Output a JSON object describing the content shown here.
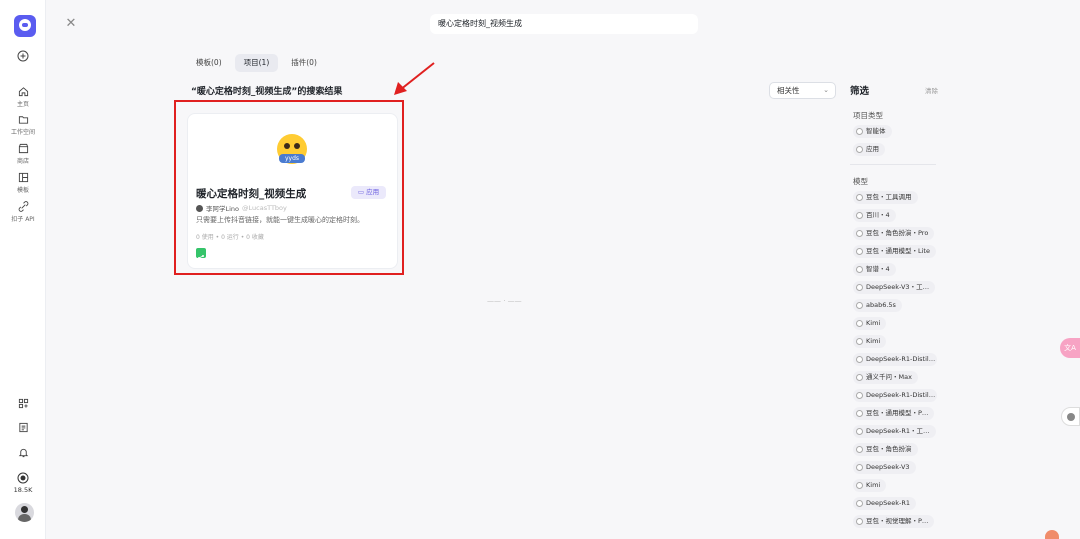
{
  "search": {
    "query": "暖心定格时刻_视频生成"
  },
  "tabs": [
    {
      "label": "模板(0)"
    },
    {
      "label": "项目(1)"
    },
    {
      "label": "插件(0)"
    }
  ],
  "results": {
    "title": "“暖心定格时刻_视频生成”的搜索结果"
  },
  "sort": {
    "value": "相关性"
  },
  "card": {
    "emoji_tag": "yyds",
    "title": "暖心定格时刻_视频生成",
    "badge": "应用",
    "author": "李阿学Lino",
    "handle": "@LucasTTboy",
    "desc": "只需要上传抖音链接，就能一键生成暖心的定格时刻。",
    "stats": "0 使用 • 0 运行 • 0 收藏"
  },
  "end_marker": "—— · ——",
  "rail": {
    "home": "主页",
    "workspace": "工作空间",
    "store": "商店",
    "templates": "模板",
    "api": "扣子 API",
    "count": "18.5K"
  },
  "filters": {
    "title": "筛选",
    "clear": "清除",
    "project_type_title": "项目类型",
    "project_types": [
      "智能体",
      "应用"
    ],
    "model_title": "模型",
    "models": [
      "豆包・工具调用",
      "百川・4",
      "豆包・角色扮演・Pro",
      "豆包・通用模型・Lite",
      "智谱・4",
      "DeepSeek-V3・工…",
      "abab6.5s",
      "Kimi",
      "Kimi",
      "DeepSeek-R1-Distil…",
      "通义千问・Max",
      "DeepSeek-R1-Distil…",
      "豆包・通用模型・P…",
      "DeepSeek-R1・工…",
      "豆包・角色扮演",
      "DeepSeek-V3",
      "Kimi",
      "DeepSeek-R1",
      "豆包・视觉理解・P…"
    ]
  },
  "floating": {
    "translate": "文A"
  }
}
